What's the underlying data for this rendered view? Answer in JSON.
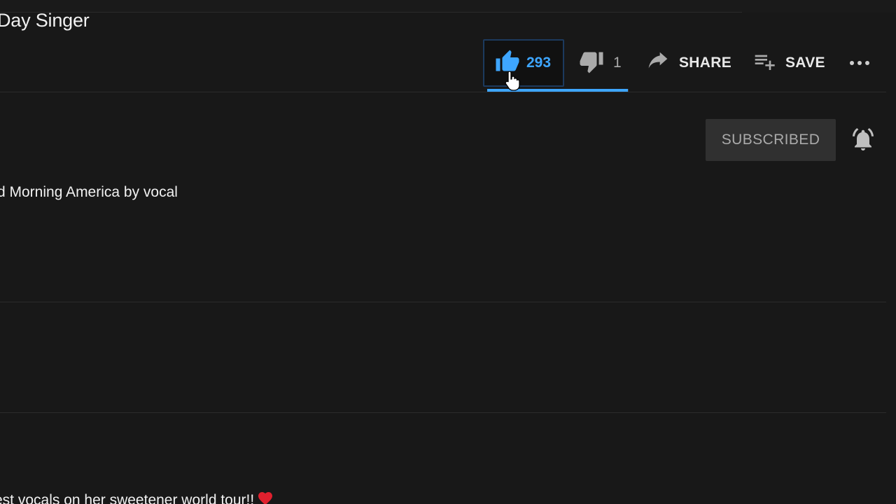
{
  "video": {
    "title": "Day Singer"
  },
  "actions": {
    "like_count": "293",
    "dislike_count": "1",
    "share_label": "SHARE",
    "save_label": "SAVE",
    "like_ratio": 0.997,
    "like_color": "#3ea6ff"
  },
  "channel": {
    "subscribe_label": "SUBSCRIBED"
  },
  "description": {
    "line": "d Morning America by vocal"
  },
  "comment": {
    "text": "est vocals on her sweetener world tour!!",
    "emoji": "heart-icon"
  },
  "icons": {
    "like": "thumbs-up-icon",
    "dislike": "thumbs-down-icon",
    "share": "share-arrow-icon",
    "save": "playlist-add-icon",
    "more": "more-horizontal-icon",
    "bell": "bell-icon",
    "cursor": "hand-pointer-icon"
  }
}
